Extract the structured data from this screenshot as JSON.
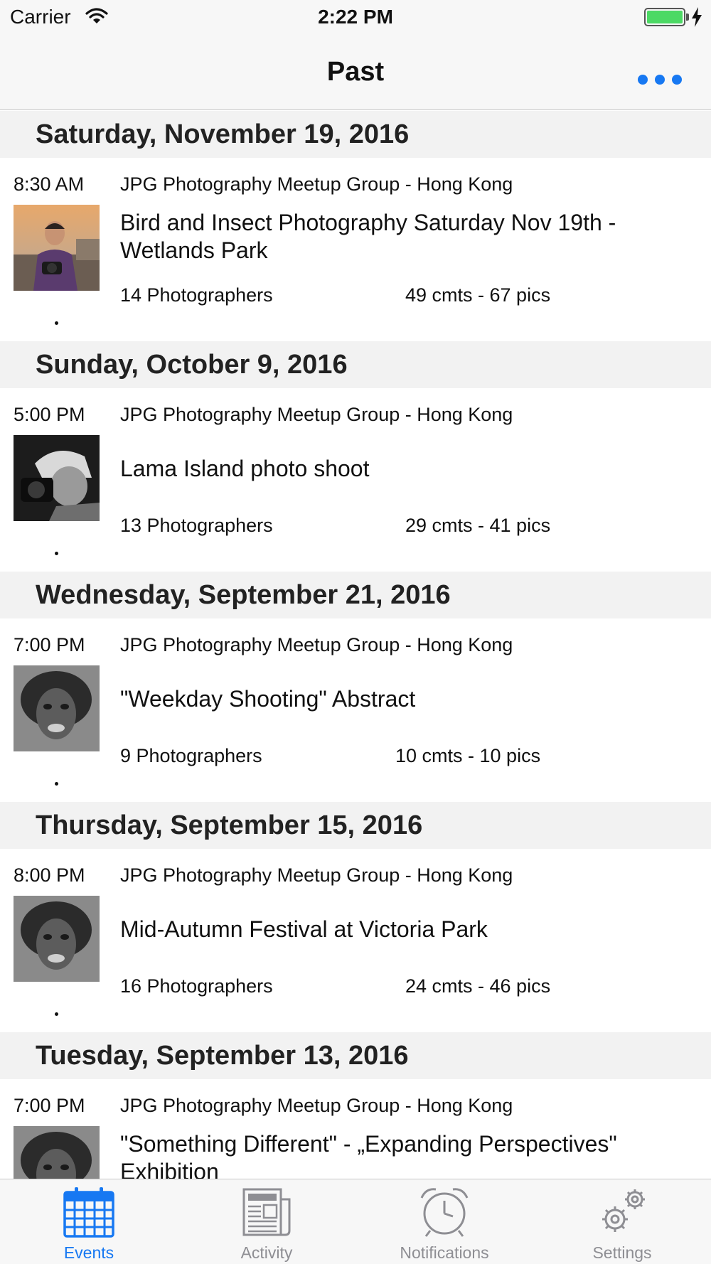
{
  "status_bar": {
    "carrier": "Carrier",
    "time": "2:22 PM",
    "wifi_icon": "wifi-icon",
    "battery_icon": "battery-charging-icon"
  },
  "nav": {
    "title": "Past",
    "more_icon": "more-dots-icon",
    "accent_color": "#1778f2"
  },
  "sections": [
    {
      "date": "Saturday, November 19, 2016",
      "event": {
        "time": "8:30 AM",
        "group": "JPG Photography Meetup Group - Hong Kong",
        "title": "Bird and Insect Photography Saturday Nov 19th - Wetlands Park",
        "photographers": "14 Photographers",
        "stats": "49 cmts - 67 pics"
      }
    },
    {
      "date": "Sunday, October 9, 2016",
      "event": {
        "time": "5:00 PM",
        "group": "JPG Photography Meetup Group - Hong Kong",
        "title": "Lama Island photo shoot",
        "photographers": "13 Photographers",
        "stats": "29 cmts - 41 pics"
      }
    },
    {
      "date": "Wednesday, September 21, 2016",
      "event": {
        "time": "7:00 PM",
        "group": "JPG Photography Meetup Group - Hong Kong",
        "title": "\"Weekday Shooting\" Abstract",
        "photographers": "9 Photographers",
        "stats": "10 cmts - 10 pics"
      }
    },
    {
      "date": "Thursday, September 15, 2016",
      "event": {
        "time": "8:00 PM",
        "group": "JPG Photography Meetup Group - Hong Kong",
        "title": "Mid-Autumn Festival at Victoria Park",
        "photographers": "16 Photographers",
        "stats": "24 cmts - 46 pics"
      }
    },
    {
      "date": "Tuesday, September 13, 2016",
      "event": {
        "time": "7:00 PM",
        "group": "JPG Photography Meetup Group - Hong Kong",
        "title": "\"Something Different\" - „Expanding Perspectives\" Exhibition"
      }
    }
  ],
  "tabs": [
    {
      "label": "Events",
      "icon": "calendar-icon",
      "active": true
    },
    {
      "label": "Activity",
      "icon": "newspaper-icon",
      "active": false
    },
    {
      "label": "Notifications",
      "icon": "alarm-clock-icon",
      "active": false
    },
    {
      "label": "Settings",
      "icon": "gears-icon",
      "active": false
    }
  ]
}
